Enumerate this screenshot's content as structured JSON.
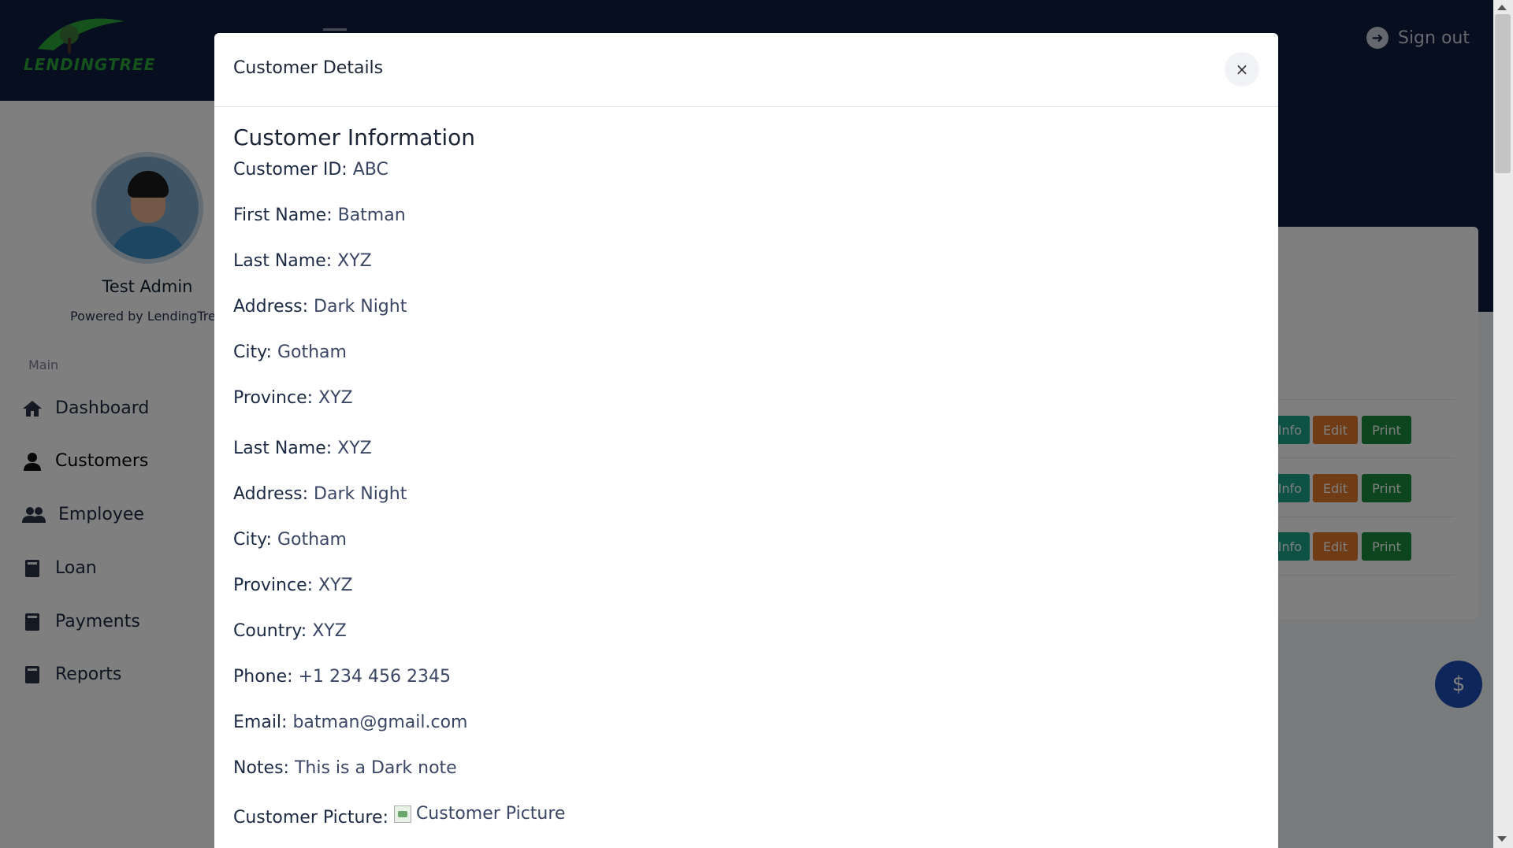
{
  "app": {
    "logo_text": "LENDINGTREE",
    "sign_out_label": "Sign out"
  },
  "sidebar": {
    "admin_name": "Test Admin",
    "powered_by": "Powered by LendingTree",
    "section_label": "Main",
    "items": [
      {
        "label": "Dashboard",
        "icon": "home-icon"
      },
      {
        "label": "Customers",
        "icon": "user-icon"
      },
      {
        "label": "Employee",
        "icon": "users-icon"
      },
      {
        "label": "Loan",
        "icon": "book-icon"
      },
      {
        "label": "Payments",
        "icon": "book-icon"
      },
      {
        "label": "Reports",
        "icon": "book-icon"
      }
    ]
  },
  "table_actions": {
    "info_label": "Info",
    "edit_label": "Edit",
    "print_label": "Print"
  },
  "fab": {
    "label": "$"
  },
  "modal": {
    "title": "Customer Details",
    "close_label": "×",
    "section_title": "Customer Information",
    "fields": [
      {
        "label": "Customer ID:",
        "value": "ABC"
      },
      {
        "label": "First Name:",
        "value": "Batman"
      },
      {
        "label": "Last Name:",
        "value": "XYZ"
      },
      {
        "label": "Address:",
        "value": "Dark Night"
      },
      {
        "label": "City:",
        "value": "Gotham"
      },
      {
        "label": "Province:",
        "value": "XYZ"
      },
      {
        "label": "Last Name:",
        "value": "XYZ"
      },
      {
        "label": "Address:",
        "value": "Dark Night"
      },
      {
        "label": "City:",
        "value": "Gotham"
      },
      {
        "label": "Province:",
        "value": "XYZ"
      },
      {
        "label": "Country:",
        "value": "XYZ"
      },
      {
        "label": "Phone:",
        "value": "+1 234 456 2345"
      },
      {
        "label": "Email:",
        "value": "batman@gmail.com"
      },
      {
        "label": "Notes:",
        "value": "This is a Dark note"
      }
    ],
    "picture_label": "Customer Picture:",
    "picture_alt": "Customer Picture"
  },
  "colors": {
    "navbar": "#0e1d3e",
    "info": "#1aa489",
    "edit": "#e0782b",
    "print": "#1a8a3c",
    "fab": "#1c4db3"
  }
}
